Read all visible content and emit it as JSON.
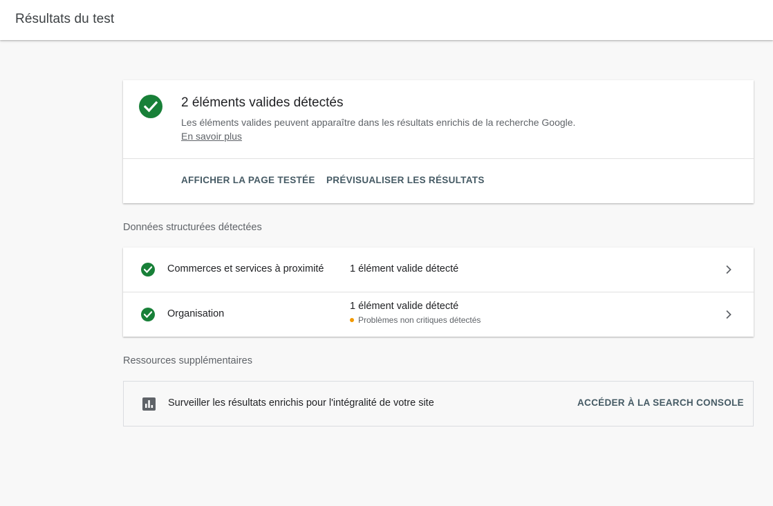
{
  "header": {
    "title": "Résultats du test"
  },
  "summary": {
    "title": "2 éléments valides détectés",
    "description": "Les éléments valides peuvent apparaître dans les résultats enrichis de la recherche Google.",
    "learn_more": "En savoir plus",
    "actions": [
      "AFFICHER LA PAGE TESTÉE",
      "PRÉVISUALISER LES RÉSULTATS"
    ],
    "status_color": "#188038"
  },
  "structured_data": {
    "section_label": "Données structurées détectées",
    "items": [
      {
        "name": "Commerces et services à proximité",
        "status": "1 élément valide détecté",
        "warning": ""
      },
      {
        "name": "Organisation",
        "status": "1 élément valide détecté",
        "warning": "Problèmes non critiques détectés"
      }
    ],
    "warning_color": "#f29900"
  },
  "resources": {
    "section_label": "Ressources supplémentaires",
    "text": "Surveiller les résultats enrichis pour l'intégralité de votre site",
    "link": "ACCÉDER À LA SEARCH CONSOLE",
    "icon": "bar-chart-icon"
  }
}
